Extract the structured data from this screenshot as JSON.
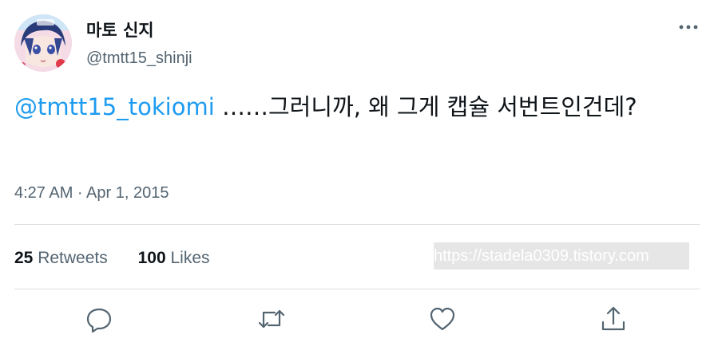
{
  "author": {
    "display_name": "마토 신지",
    "handle": "@tmtt15_shinji",
    "avatar_icon": "avatar-image"
  },
  "tweet": {
    "mention": "@tmtt15_tokiomi",
    "text": " ……그러니까, 왜 그게 캡슐 서번트인건데?",
    "timestamp": "4:27 AM · Apr 1, 2015"
  },
  "stats": {
    "retweets_count": "25",
    "retweets_label": "Retweets",
    "likes_count": "100",
    "likes_label": "Likes"
  },
  "watermark": "https://stadela0309.tistory.com",
  "actions": {
    "reply_icon": "reply-icon",
    "retweet_icon": "retweet-icon",
    "like_icon": "heart-icon",
    "share_icon": "share-icon"
  },
  "colors": {
    "accent": "#1d9bf0",
    "secondary_text": "#536471",
    "primary_text": "#0f1419",
    "divider": "#dddddd"
  }
}
